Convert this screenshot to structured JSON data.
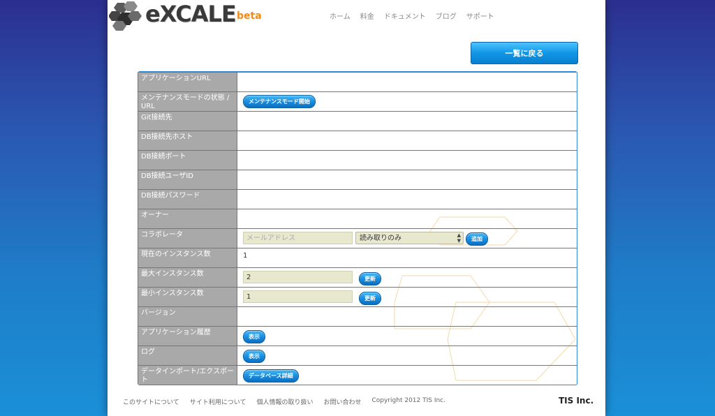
{
  "logo": {
    "name": "eXCALE",
    "suffix": "beta"
  },
  "nav": [
    "ホーム",
    "料金",
    "ドキュメント",
    "ブログ",
    "サポート"
  ],
  "back_button": "一覧に戻る",
  "rows": {
    "app_url": {
      "label": "アプリケーションURL"
    },
    "maintenance": {
      "label": "メンテナンスモードの状態 / URL",
      "button": "メンテナンスモード開始"
    },
    "git": {
      "label": "Git接続先"
    },
    "db_host": {
      "label": "DB接続先ホスト"
    },
    "db_port": {
      "label": "DB接続ポート"
    },
    "db_user": {
      "label": "DB接続ユーザID"
    },
    "db_pass": {
      "label": "DB接続パスワード"
    },
    "owner": {
      "label": "オーナー"
    },
    "collab": {
      "label": "コラボレータ",
      "email_placeholder": "メールアドレス",
      "permission": "読み取りのみ",
      "add_button": "追加"
    },
    "current_instances": {
      "label": "現在のインスタンス数",
      "value": "1"
    },
    "max_instances": {
      "label": "最大インスタンス数",
      "value": "2",
      "button": "更新"
    },
    "min_instances": {
      "label": "最小インスタンス数",
      "value": "1",
      "button": "更新"
    },
    "version": {
      "label": "バージョン"
    },
    "history": {
      "label": "アプリケーション履歴",
      "button": "表示"
    },
    "log": {
      "label": "ログ",
      "button": "表示"
    },
    "import_export": {
      "label": "データインポート/エクスポート",
      "button": "データベース詳細"
    }
  },
  "footer": {
    "links": [
      "このサイトについて",
      "サイト利用について",
      "個人情報の取り扱い",
      "お問い合わせ"
    ],
    "copyright": "Copyright 2012 TIS Inc.",
    "company": "TIS Inc."
  },
  "colors": {
    "accent": "#1196e6",
    "border": "#2f86d6",
    "label_bg": "#a9a9a9",
    "beta": "#f08a1c"
  }
}
